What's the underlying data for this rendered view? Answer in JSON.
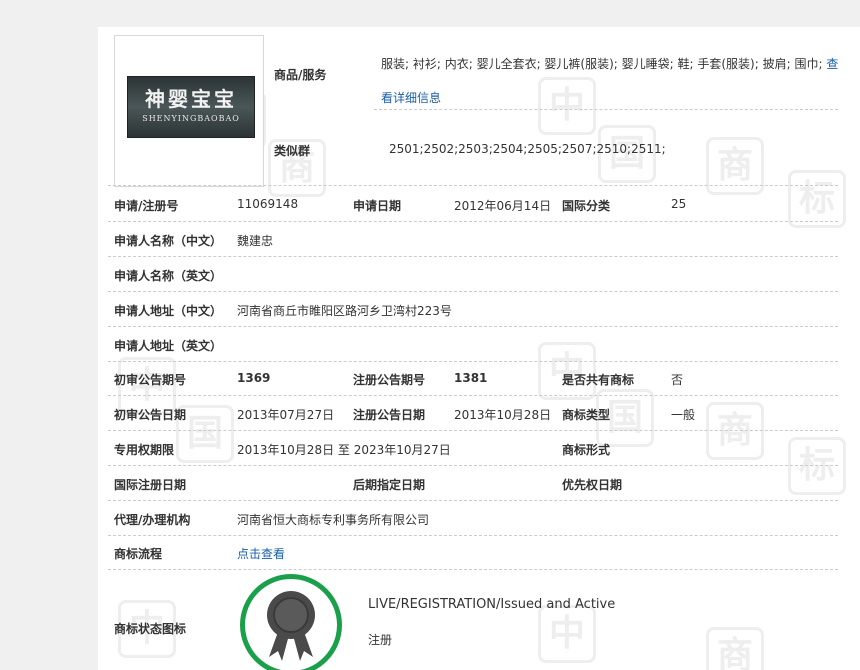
{
  "logo": {
    "chinese": "神婴宝宝",
    "english": "SHENYINGBAOBAO"
  },
  "goods": {
    "label": "商品/服务",
    "text": "服装; 衬衫; 内衣; 婴儿全套衣; 婴儿裤(服装); 婴儿睡袋; 鞋; 手套(服装); 披肩; 围巾; ",
    "link": "查看详细信息"
  },
  "similar_group": {
    "label": "类似群",
    "value": "2501;2502;2503;2504;2505;2507;2510;2511;"
  },
  "rows": {
    "reg_no": {
      "label": "申请/注册号",
      "value": "11069148"
    },
    "apply_date": {
      "label": "申请日期",
      "value": "2012年06月14日"
    },
    "intl_class": {
      "label": "国际分类",
      "value": "25"
    },
    "applicant_cn": {
      "label": "申请人名称（中文）",
      "value": "魏建忠"
    },
    "applicant_en": {
      "label": "申请人名称（英文）",
      "value": ""
    },
    "address_cn": {
      "label": "申请人地址（中文）",
      "value": "河南省商丘市睢阳区路河乡卫湾村223号"
    },
    "address_en": {
      "label": "申请人地址（英文）",
      "value": ""
    },
    "prelim_no": {
      "label": "初审公告期号",
      "value": "1369"
    },
    "reg_pub_no": {
      "label": "注册公告期号",
      "value": "1381"
    },
    "shared": {
      "label": "是否共有商标",
      "value": "否"
    },
    "prelim_date": {
      "label": "初审公告日期",
      "value": "2013年07月27日"
    },
    "reg_pub_date": {
      "label": "注册公告日期",
      "value": "2013年10月28日"
    },
    "tm_type": {
      "label": "商标类型",
      "value": "一般"
    },
    "exclusive_period": {
      "label": "专用权期限",
      "value": "2013年10月28日 至 2023年10月27日"
    },
    "tm_form": {
      "label": "商标形式",
      "value": ""
    },
    "intl_reg_date": {
      "label": "国际注册日期",
      "value": ""
    },
    "later_date": {
      "label": "后期指定日期",
      "value": ""
    },
    "priority_date": {
      "label": "优先权日期",
      "value": ""
    },
    "agent": {
      "label": "代理/办理机构",
      "value": "河南省恒大商标专利事务所有限公司"
    },
    "process": {
      "label": "商标流程",
      "value": "点击查看"
    },
    "status_icon": {
      "label": "商标状态图标",
      "status_en": "LIVE/REGISTRATION/Issued and Active",
      "status_cn": "注册"
    }
  },
  "watermark": [
    "中",
    "国",
    "商",
    "标"
  ],
  "colors": {
    "link": "#1a5fa8",
    "badge_ring": "#1aa04b",
    "badge_medal": "#4a4a4a"
  }
}
